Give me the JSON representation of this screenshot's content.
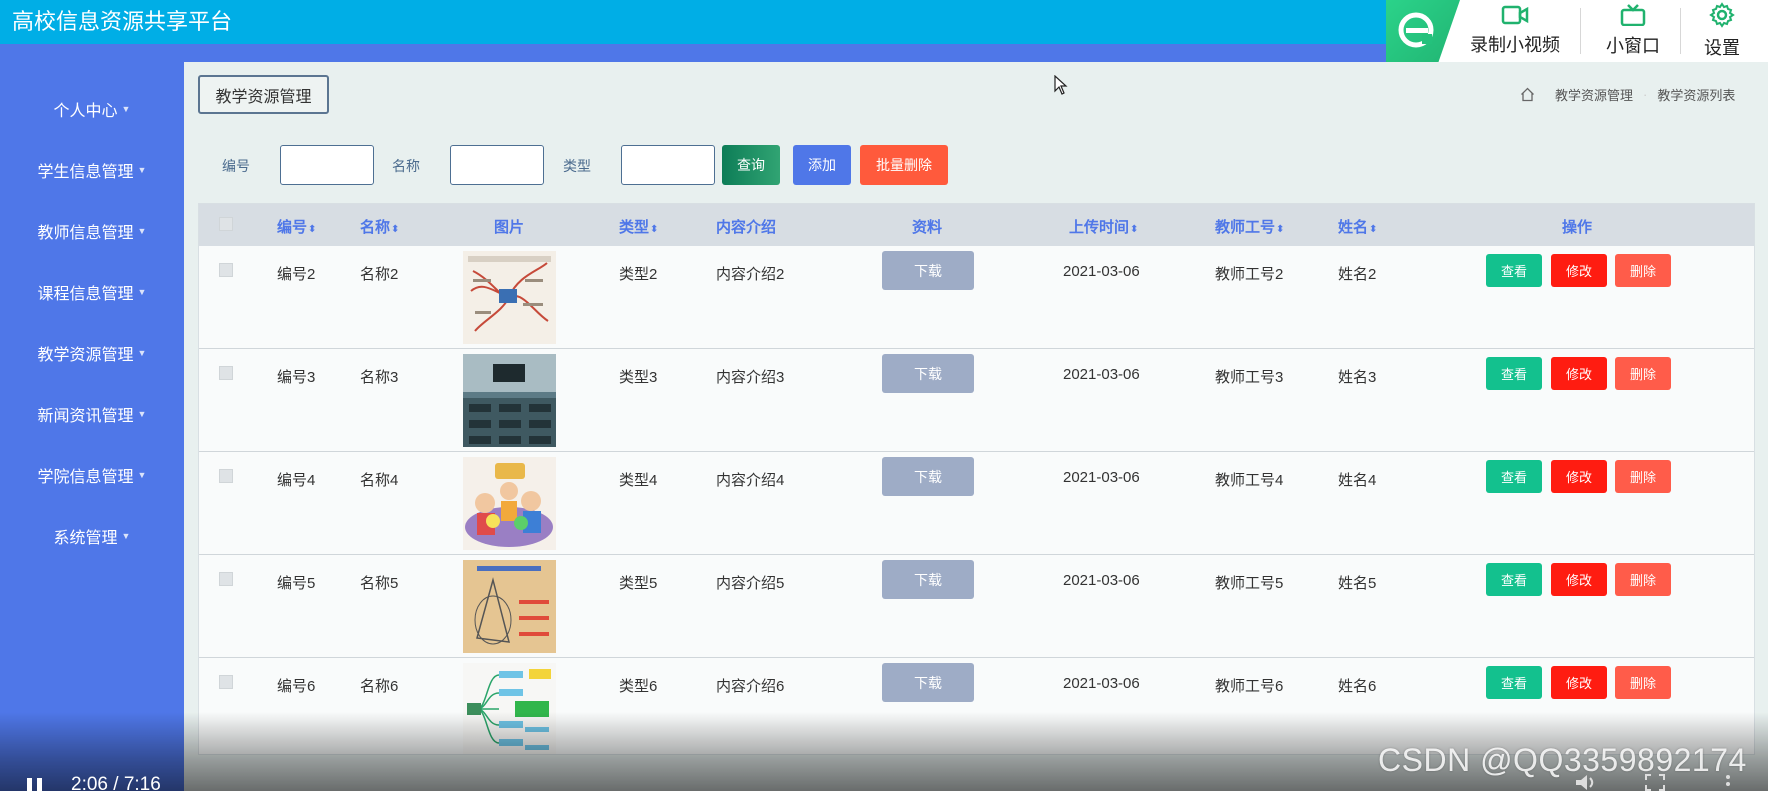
{
  "app": {
    "title": "高校信息资源共享平台"
  },
  "toolbox": {
    "record_label": "录制小视频",
    "mini_label": "小窗口",
    "settings_label": "设置"
  },
  "sidebar": {
    "items": [
      {
        "label": "个人中心"
      },
      {
        "label": "学生信息管理"
      },
      {
        "label": "教师信息管理"
      },
      {
        "label": "课程信息管理"
      },
      {
        "label": "教学资源管理"
      },
      {
        "label": "新闻资讯管理"
      },
      {
        "label": "学院信息管理"
      },
      {
        "label": "系统管理"
      }
    ]
  },
  "page": {
    "title_button": "教学资源管理",
    "breadcrumb": [
      "教学资源管理",
      "教学资源列表"
    ]
  },
  "search": {
    "fields": [
      {
        "label": "编号",
        "value": ""
      },
      {
        "label": "名称",
        "value": ""
      },
      {
        "label": "类型",
        "value": ""
      }
    ],
    "query_label": "查询",
    "add_label": "添加",
    "bulk_delete_label": "批量删除"
  },
  "table": {
    "headers": [
      "编号",
      "名称",
      "图片",
      "类型",
      "内容介绍",
      "资料",
      "上传时间",
      "教师工号",
      "姓名",
      "操作"
    ],
    "sort_icon": "⬍",
    "download_label": "下载",
    "view_label": "查看",
    "edit_label": "修改",
    "delete_label": "删除",
    "rows": [
      {
        "id": "编号2",
        "name": "名称2",
        "image": "mind-map",
        "type": "类型2",
        "intro": "内容介绍2",
        "date": "2021-03-06",
        "teacher_no": "教师工号2",
        "teacher_name": "姓名2"
      },
      {
        "id": "编号3",
        "name": "名称3",
        "image": "classroom",
        "type": "类型3",
        "intro": "内容介绍3",
        "date": "2021-03-06",
        "teacher_no": "教师工号3",
        "teacher_name": "姓名3"
      },
      {
        "id": "编号4",
        "name": "名称4",
        "image": "english-kids",
        "type": "类型4",
        "intro": "内容介绍4",
        "date": "2021-03-06",
        "teacher_no": "教师工号4",
        "teacher_name": "姓名4"
      },
      {
        "id": "编号5",
        "name": "名称5",
        "image": "geometry",
        "type": "类型5",
        "intro": "内容介绍5",
        "date": "2021-03-06",
        "teacher_no": "教师工号5",
        "teacher_name": "姓名5"
      },
      {
        "id": "编号6",
        "name": "名称6",
        "image": "tree-diagram",
        "type": "类型6",
        "intro": "内容介绍6",
        "date": "2021-03-06",
        "teacher_no": "教师工号6",
        "teacher_name": "姓名6"
      }
    ]
  },
  "video": {
    "time": "2:06 / 7:16",
    "watermark": "CSDN @QQ3359892174"
  },
  "colors": {
    "header": "#00aee6",
    "sidebar": "#4f77e8",
    "view": "#13c18e",
    "edit": "#ff1c11",
    "delete": "#ff5c4a"
  }
}
